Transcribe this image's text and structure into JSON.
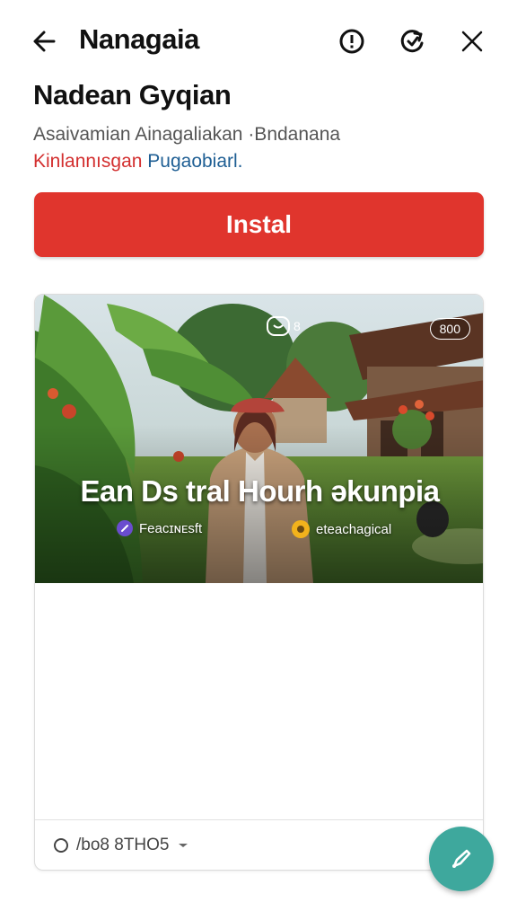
{
  "header": {
    "app_title": "Nanagaia",
    "icons": [
      "back-arrow-icon",
      "info-icon",
      "share-icon",
      "close-icon"
    ]
  },
  "content": {
    "heading": "Nadean Gyqian",
    "description_line1": "Asaivamian Ainagaliakan ·Bndanana",
    "description_line2_red": "Kinlannısgan",
    "description_line2_blue": " Pugaobiarl.",
    "install_label": "Instal"
  },
  "card": {
    "overlay_title": "Ean Ds tral Hourh əkunpia",
    "chip_left_label": "Feaᴄɪɴᴇsft",
    "chip_right_label": "eteachagical",
    "badge_label": "800",
    "logo_text": "8",
    "footer_label": "/bo8 8THO5"
  },
  "colors": {
    "accent_red": "#e0352d",
    "fab_teal": "#3ea89d",
    "text_red": "#d32f2f",
    "text_blue": "#1f5f94"
  }
}
